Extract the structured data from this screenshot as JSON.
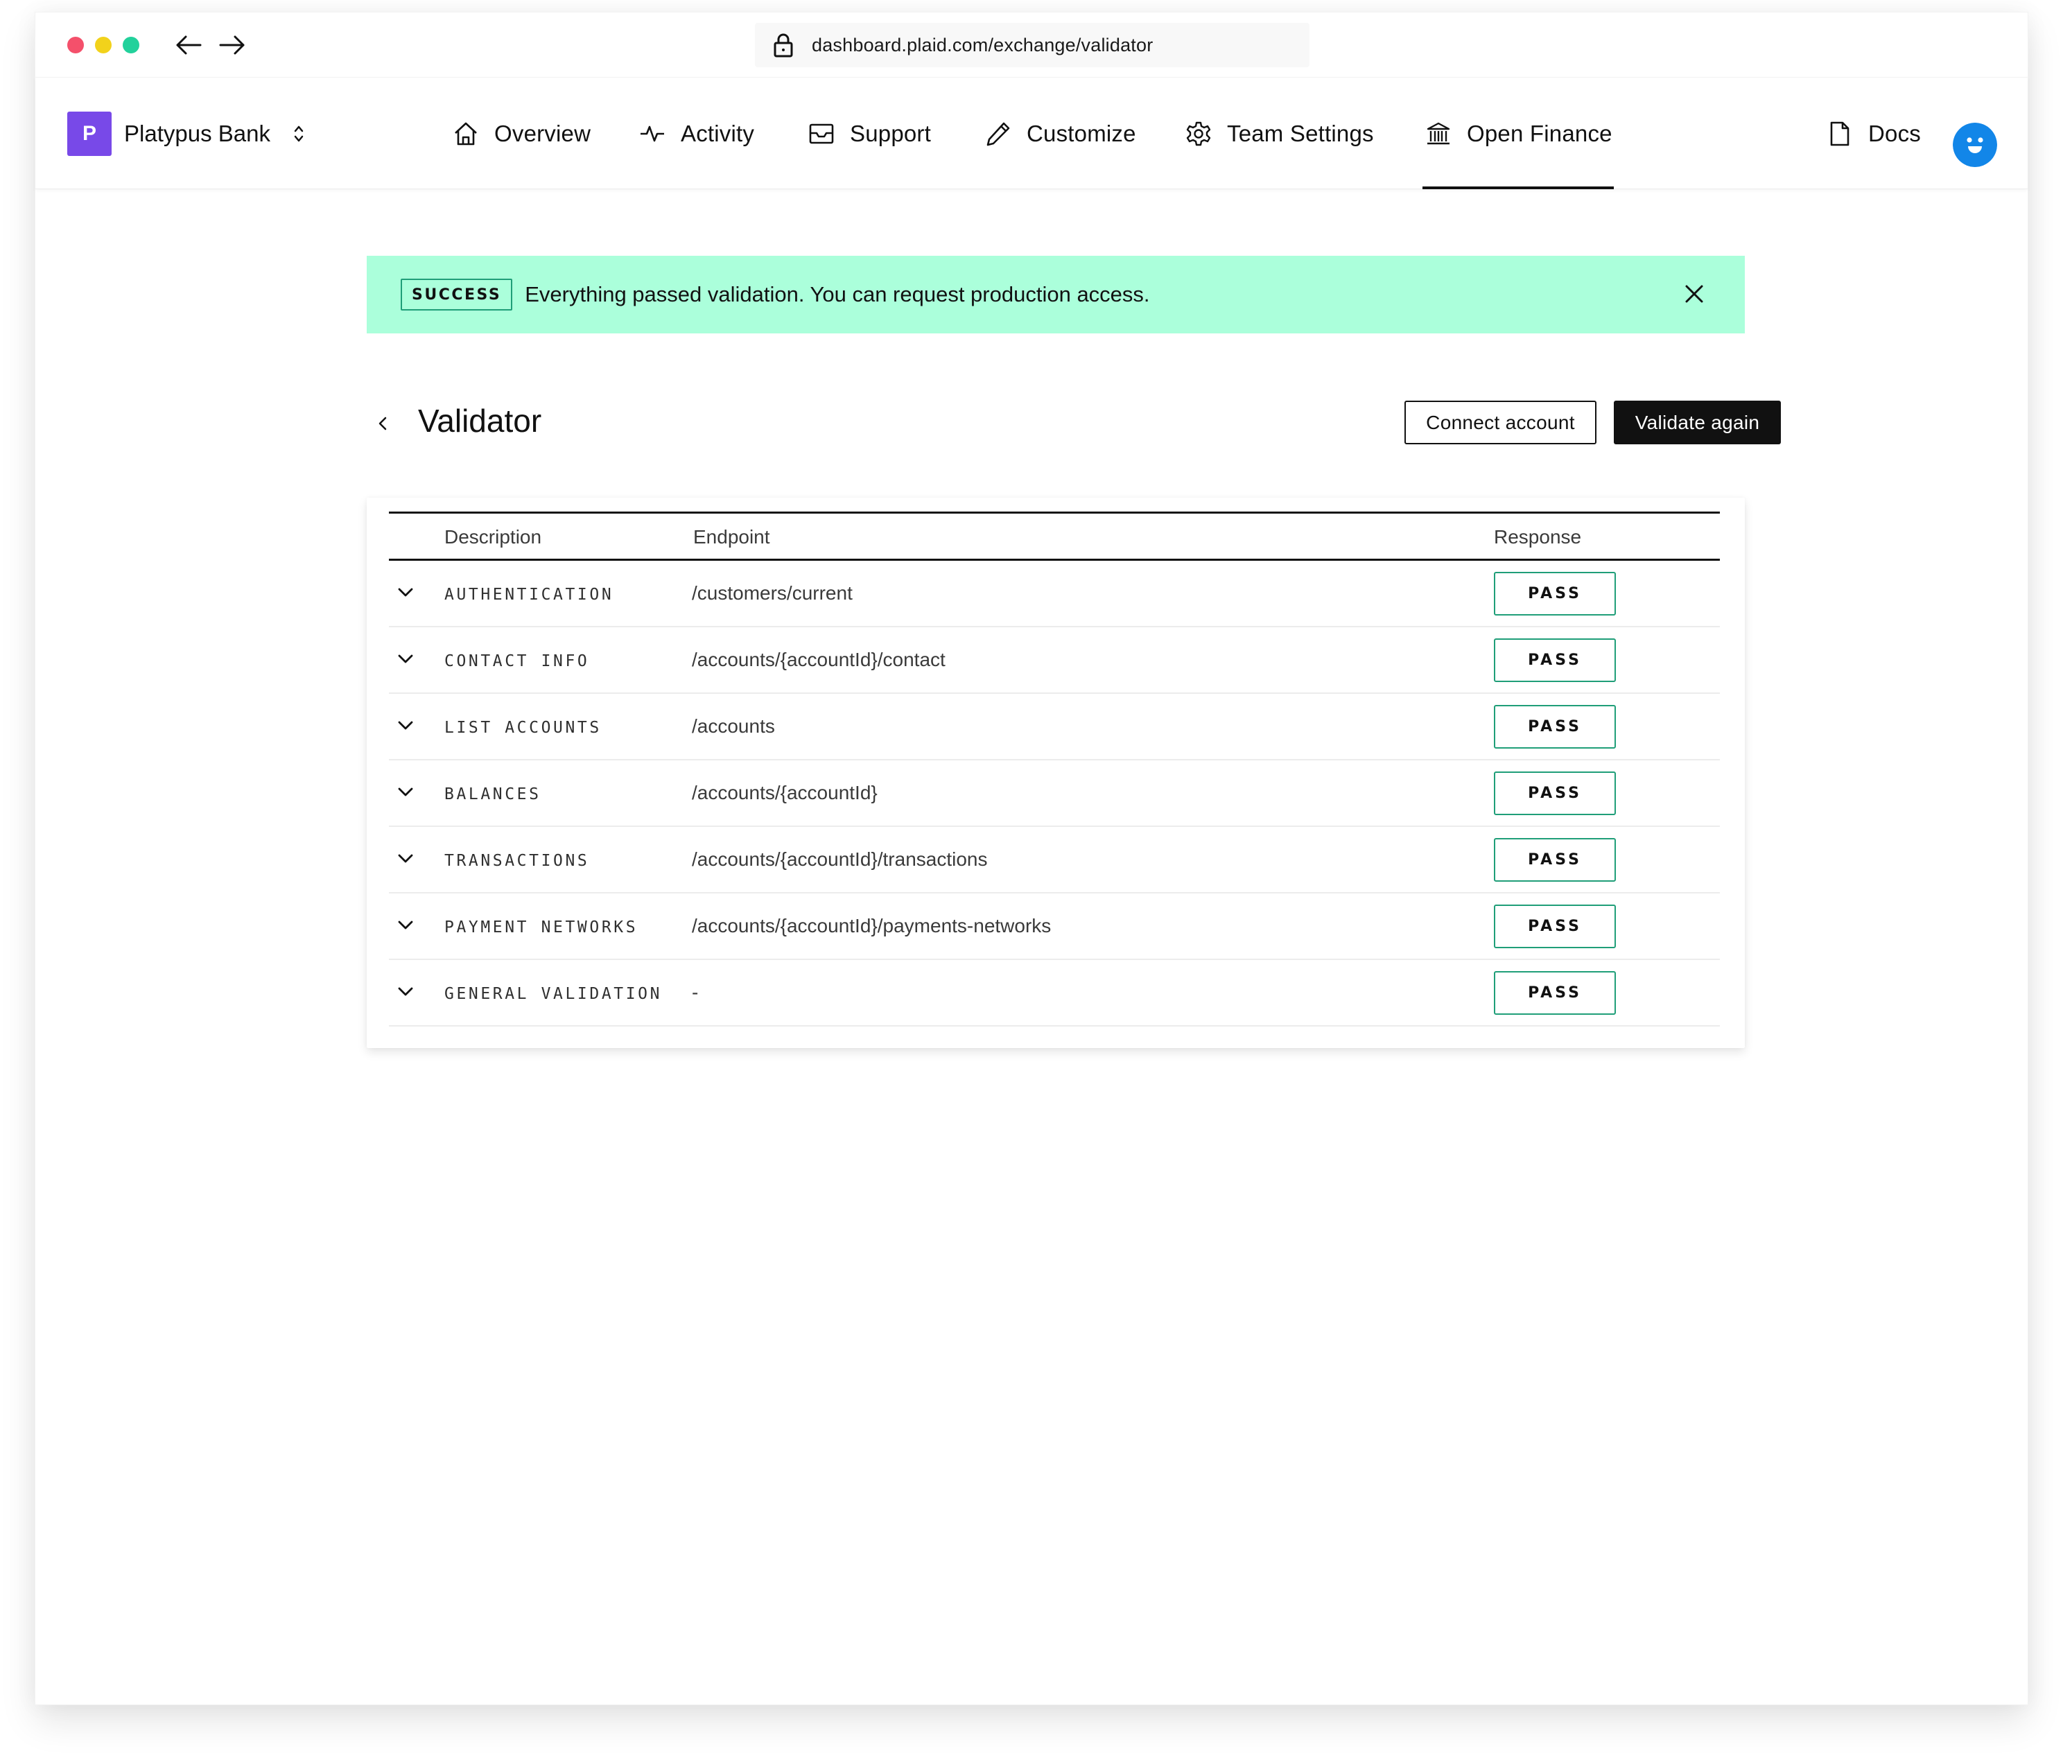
{
  "browser": {
    "url": "dashboard.plaid.com/exchange/validator",
    "traffic_lights": {
      "close": "#F4506B",
      "minimize": "#F2D21B",
      "maximize": "#22D19B"
    }
  },
  "brand": {
    "logo_letter": "P",
    "name": "Platypus Bank",
    "logo_color": "#7849E8"
  },
  "nav": {
    "items": [
      {
        "label": "Overview",
        "icon": "home-icon"
      },
      {
        "label": "Activity",
        "icon": "activity-icon"
      },
      {
        "label": "Support",
        "icon": "inbox-icon"
      },
      {
        "label": "Customize",
        "icon": "pencil-icon"
      },
      {
        "label": "Team Settings",
        "icon": "gear-icon"
      },
      {
        "label": "Open Finance",
        "icon": "bank-icon",
        "active": true
      }
    ],
    "docs_label": "Docs",
    "avatar_color": "#1286E8"
  },
  "banner": {
    "badge": "SUCCESS",
    "message": "Everything passed validation. You can request production access.",
    "background": "#ABFFDB",
    "accent": "#1F9E78"
  },
  "page": {
    "title": "Validator",
    "connect_button": "Connect account",
    "validate_button": "Validate again"
  },
  "table": {
    "headers": {
      "description": "Description",
      "endpoint": "Endpoint",
      "response": "Response"
    },
    "rows": [
      {
        "description": "AUTHENTICATION",
        "endpoint": "/customers/current",
        "response": "PASS"
      },
      {
        "description": "CONTACT INFO",
        "endpoint": "/accounts/{accountId}/contact",
        "response": "PASS"
      },
      {
        "description": "LIST ACCOUNTS",
        "endpoint": "/accounts",
        "response": "PASS"
      },
      {
        "description": "BALANCES",
        "endpoint": "/accounts/{accountId}",
        "response": "PASS"
      },
      {
        "description": "TRANSACTIONS",
        "endpoint": "/accounts/{accountId}/transactions",
        "response": "PASS"
      },
      {
        "description": "PAYMENT NETWORKS",
        "endpoint": "/accounts/{accountId}/payments-networks",
        "response": "PASS"
      },
      {
        "description": "GENERAL VALIDATION",
        "endpoint": "-",
        "response": "PASS"
      }
    ]
  }
}
